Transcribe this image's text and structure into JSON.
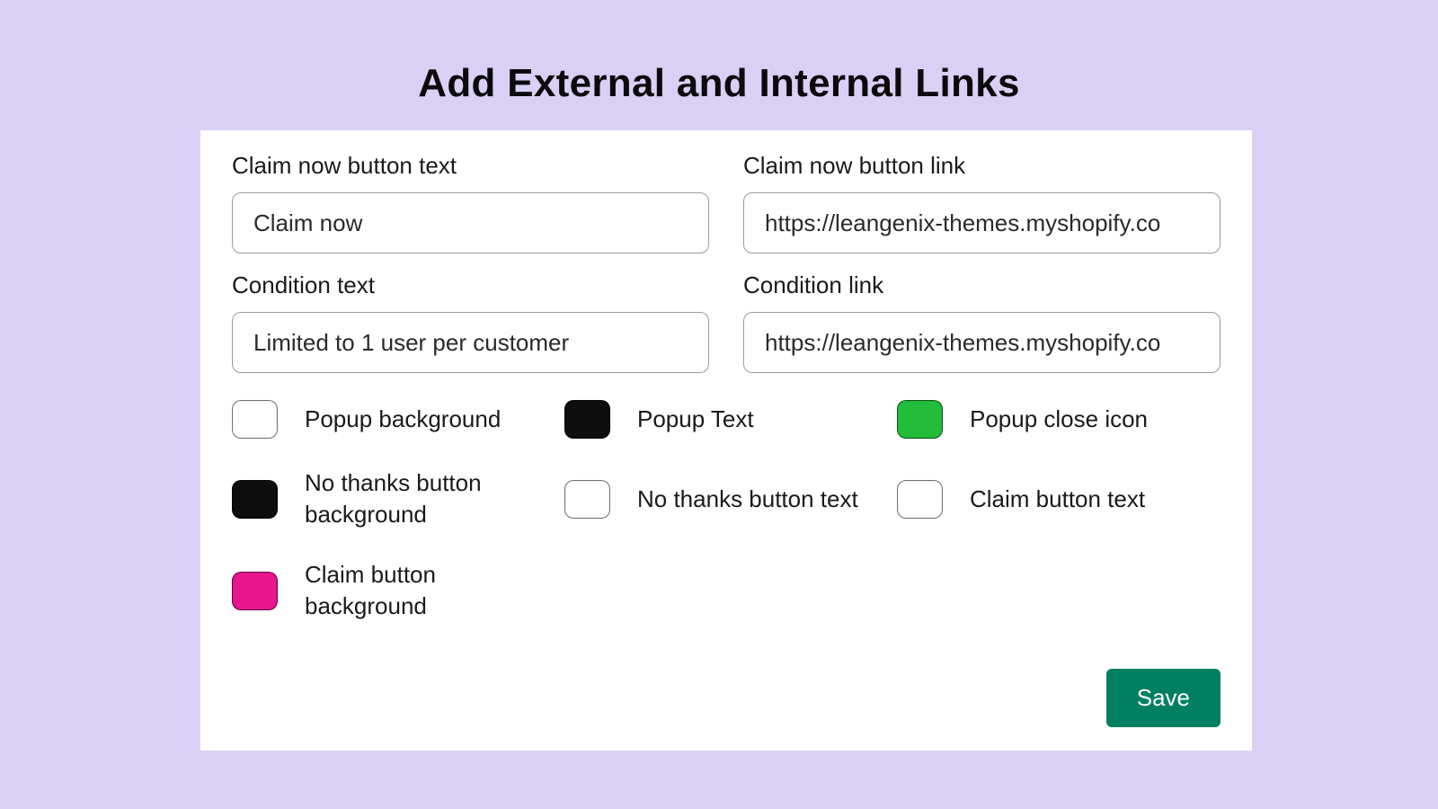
{
  "title": "Add External and Internal Links",
  "fields": {
    "claim_text": {
      "label": "Claim now button text",
      "value": "Claim now"
    },
    "claim_link": {
      "label": "Claim now button link",
      "value": "https://leangenix-themes.myshopify.co"
    },
    "condition_text": {
      "label": "Condition text",
      "value": "Limited to 1 user per customer"
    },
    "condition_link": {
      "label": "Condition link",
      "value": "https://leangenix-themes.myshopify.co"
    }
  },
  "swatches": {
    "popup_bg": {
      "label": "Popup background",
      "color": "#ffffff"
    },
    "popup_text": {
      "label": "Popup Text",
      "color": "#0d0d0d"
    },
    "popup_close": {
      "label": "Popup close icon",
      "color": "#23bd3b"
    },
    "no_thanks_bg": {
      "label": "No thanks button background",
      "color": "#0d0d0d"
    },
    "no_thanks_text": {
      "label": "No thanks button text",
      "color": "#ffffff"
    },
    "claim_btn_text": {
      "label": "Claim button text",
      "color": "#ffffff"
    },
    "claim_btn_bg": {
      "label": "Claim button background",
      "color": "#e7168f"
    }
  },
  "actions": {
    "save_label": "Save"
  }
}
